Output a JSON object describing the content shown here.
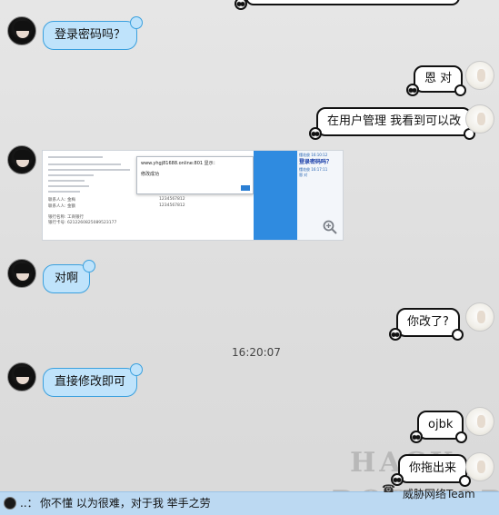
{
  "messages": {
    "m1": "登录密码吗？",
    "m2": "恩 对",
    "m3": "在用户管理 我看到可以改",
    "m4": "对啊",
    "m5": "你改了?",
    "m6": "直接修改即可",
    "m7": "ojbk",
    "m8": "你拖出来"
  },
  "timestamp": "16:20:07",
  "screenshot": {
    "dialog_title": "www.yhgj81688.online:801 显示：",
    "dialog_text": "修改成功",
    "side_title": "登录密码吗？",
    "side_name_1": "懂花俊",
    "side_time_1": "16:10:12",
    "side_name_2": "懂花俊",
    "side_time_2": "16:17:11",
    "side_reply": "恩 对",
    "row_1a": "联系人人: 金梅",
    "row_1b": "1234567812",
    "row_2a": "联系人人: 金额",
    "row_2b": "1234567812",
    "bank_1": "银行名称: 工商银行",
    "bank_2": "银行卡号: 6212260825089523177"
  },
  "watermark": {
    "line1": "HACK",
    "line2": "DOOR.ORG",
    "team": "威胁网络Team"
  },
  "bottom_bar": {
    "prefix": "..：",
    "text": "你不懂 以为很难，对于我 举手之劳"
  },
  "colors": {
    "bubble_left_bg": "#bfe3fb",
    "bubble_left_border": "#3aa0de",
    "bubble_right_bg": "#ffffff",
    "bottom_bar_bg": "#bcd9f2"
  }
}
